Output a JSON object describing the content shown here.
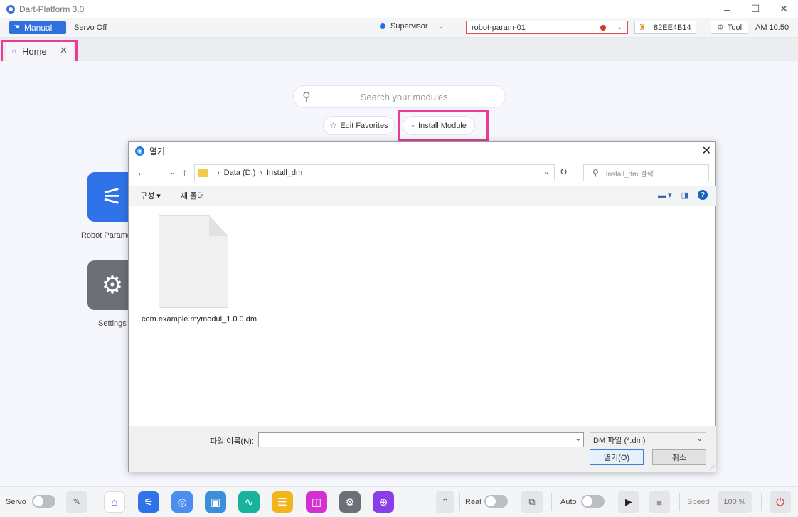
{
  "window": {
    "title": "Dart-Platform 3.0",
    "controls": {
      "minimize": "–",
      "maximize": "☐",
      "close": "✕"
    }
  },
  "toolbar": {
    "mode_label": "Manual",
    "servo_state": "Servo Off",
    "user_role": "Supervisor",
    "robot_selected": "robot-param-01",
    "serial": "82EE4B14",
    "tool_label": "Tool",
    "clock": "AM 10:50"
  },
  "tabs": [
    {
      "label": "Home",
      "close": "✕"
    }
  ],
  "home": {
    "search_placeholder": "Search your modules",
    "edit_favorites_label": "Edit Favorites",
    "install_module_label": "Install Module",
    "tiles": [
      {
        "label": "Robot Parame",
        "icon": "robot-arm-icon"
      },
      {
        "label": "Settings",
        "icon": "gear-icon"
      }
    ]
  },
  "dialog": {
    "title": "열기",
    "path": [
      "Data (D:)",
      "Install_dm"
    ],
    "search_placeholder": "Install_dm 검색",
    "organize_label": "구성 ▾",
    "new_folder_label": "새 폴더",
    "files": [
      {
        "name": "com.example.mymodul_1.0.0.dm"
      }
    ],
    "filename_label": "파일 이름(N):",
    "filename_value": "",
    "filetype_selected": "DM 파일 (*.dm)",
    "open_label": "열기(O)",
    "cancel_label": "취소"
  },
  "bottombar": {
    "servo_label": "Servo",
    "real_label": "Real",
    "auto_label": "Auto",
    "speed_label": "Speed",
    "speed_value": "100 %",
    "apps": [
      {
        "icon": "home-icon",
        "color": "#ffffff"
      },
      {
        "icon": "robot-arm-icon",
        "color": "#2f73ea"
      },
      {
        "icon": "wireless-icon",
        "color": "#4c8ef0"
      },
      {
        "icon": "task-writer-icon",
        "color": "#3a8fd8"
      },
      {
        "icon": "monitor-icon",
        "color": "#19b39b"
      },
      {
        "icon": "notes-icon",
        "color": "#f2b51d"
      },
      {
        "icon": "store-icon",
        "color": "#d32fd1"
      },
      {
        "icon": "gear-icon",
        "color": "#6c6f75"
      },
      {
        "icon": "target-icon",
        "color": "#8a3ee8"
      }
    ]
  },
  "colors": {
    "accent": "#2f6fe0",
    "highlight": "#ea3c97",
    "alarm": "#d9342b"
  }
}
